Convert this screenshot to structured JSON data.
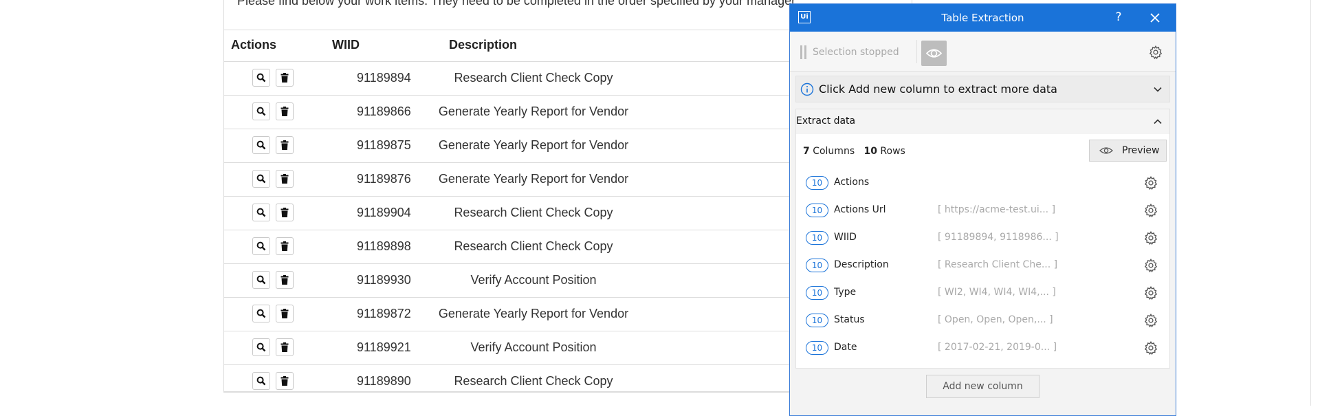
{
  "page": {
    "intro_text": "Please find below your work items. They need to be completed in the order specified by your manager.",
    "headers": {
      "actions": "Actions",
      "wiid": "WIID",
      "description": "Description"
    },
    "rows": [
      {
        "wiid": "91189894",
        "description": "Research Client Check Copy"
      },
      {
        "wiid": "91189866",
        "description": "Generate Yearly Report for Vendor"
      },
      {
        "wiid": "91189875",
        "description": "Generate Yearly Report for Vendor"
      },
      {
        "wiid": "91189876",
        "description": "Generate Yearly Report for Vendor"
      },
      {
        "wiid": "91189904",
        "description": "Research Client Check Copy"
      },
      {
        "wiid": "91189898",
        "description": "Research Client Check Copy"
      },
      {
        "wiid": "91189930",
        "description": "Verify Account Position"
      },
      {
        "wiid": "91189872",
        "description": "Generate Yearly Report for Vendor"
      },
      {
        "wiid": "91189921",
        "description": "Verify Account Position"
      },
      {
        "wiid": "91189890",
        "description": "Research Client Check Copy"
      }
    ],
    "row_icons": [
      "search-icon",
      "trash-icon"
    ]
  },
  "dialog": {
    "app_icon_label": "Ui",
    "title": "Table Extraction",
    "help_label": "?",
    "selection_status": "Selection stopped",
    "info_text": "Click Add new column to extract more data",
    "extract_title": "Extract data",
    "column_count": "7",
    "columns_label": "Columns",
    "row_count": "10",
    "rows_label": "Rows",
    "preview_label": "Preview",
    "columns": [
      {
        "count": "10",
        "name": "Actions",
        "preview": ""
      },
      {
        "count": "10",
        "name": "Actions Url",
        "preview": "[ https://acme-test.ui... ]"
      },
      {
        "count": "10",
        "name": "WIID",
        "preview": "[ 91189894, 9118986... ]"
      },
      {
        "count": "10",
        "name": "Description",
        "preview": "[ Research Client Che... ]"
      },
      {
        "count": "10",
        "name": "Type",
        "preview": "[ WI2, WI4, WI4, WI4,... ]"
      },
      {
        "count": "10",
        "name": "Status",
        "preview": "[ Open, Open, Open,... ]"
      },
      {
        "count": "10",
        "name": "Date",
        "preview": "[ 2017-02-21, 2019-0... ]"
      }
    ],
    "add_column_label": "Add new column"
  },
  "colors": {
    "accent": "#1a73d9",
    "border": "#dcdcdc"
  }
}
